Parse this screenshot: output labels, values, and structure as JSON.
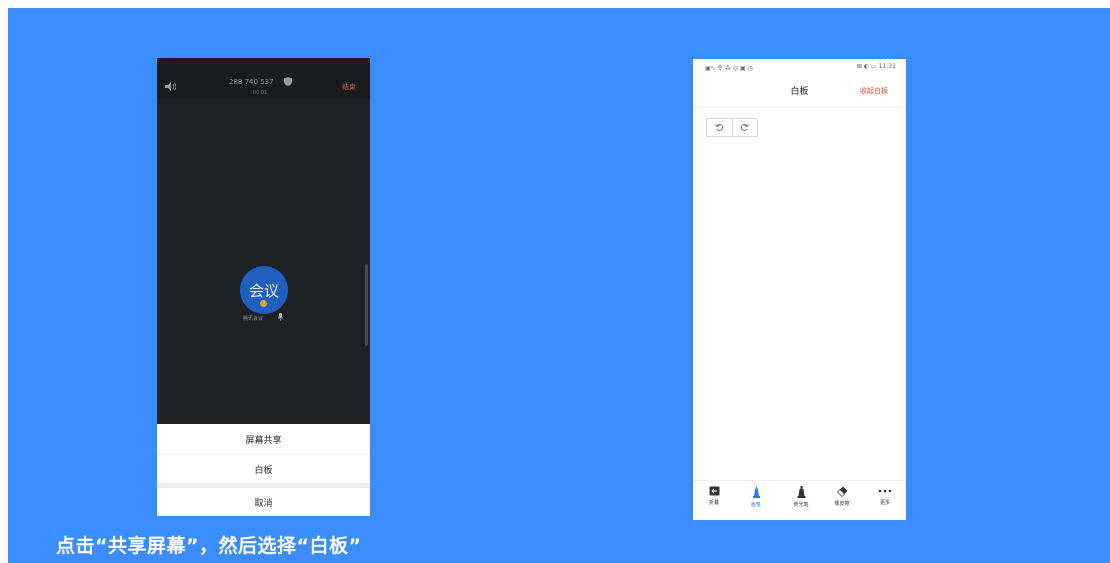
{
  "left_phone": {
    "meeting_id": "288 740 537",
    "meeting_time": "00:01",
    "end_button": "结束",
    "avatar_text": "会议",
    "participant_name": "腾讯会议",
    "sheet": {
      "share_screen": "屏幕共享",
      "whiteboard": "白板",
      "cancel": "取消"
    }
  },
  "right_phone": {
    "status_left": "▣ᵃᵢₗ 令 ⁂ ◎ ▣ ◷",
    "status_right": "⊠ ◐ ▭ 11:31",
    "title": "白板",
    "collapse_button": "收起白板",
    "toolbar": [
      {
        "label": "折叠",
        "icon": "fold-icon"
      },
      {
        "label": "画笔",
        "icon": "pen-icon",
        "active": true
      },
      {
        "label": "荧光笔",
        "icon": "highlighter-icon"
      },
      {
        "label": "橡皮擦",
        "icon": "eraser-icon"
      },
      {
        "label": "更多",
        "icon": "more-icon"
      }
    ]
  },
  "caption": "点击“共享屏幕”，然后选择“白板”",
  "colors": {
    "background": "#3b8cff",
    "accent_blue": "#2f7cf6",
    "accent_red": "#e0443b"
  }
}
